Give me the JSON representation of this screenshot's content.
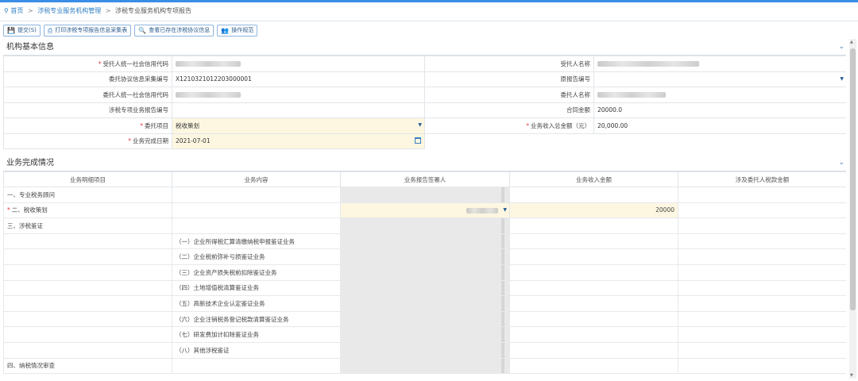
{
  "breadcrumb": {
    "home": "首页",
    "level1": "涉税专业服务机构管理",
    "level2": "涉税专业服务机构专项报告",
    "sep": ">"
  },
  "toolbar": {
    "submit": "提交(S)",
    "print": "打印涉税专项报告信息采集表",
    "view": "查看已存在涉税协议信息",
    "guide": "操作规范"
  },
  "basic": {
    "title": "机构基本信息",
    "rows": [
      {
        "l1": "受托人统一社会信用代码",
        "v1": "",
        "l2": "受托人名称",
        "v2": ""
      },
      {
        "l1": "委托协议信息采集编号",
        "v1": "X1210321012203000001",
        "l2": "原报告编号",
        "v2": ""
      },
      {
        "l1": "委托人统一社会信用代码",
        "v1": "",
        "l2": "委托人名称",
        "v2": ""
      },
      {
        "l1": "涉税专项业务报告编号",
        "v1": "",
        "l2": "合同金额",
        "v2": "20000.0"
      },
      {
        "l1": "委托项目",
        "v1": "税收策划",
        "l2": "业务收入总金额（元）",
        "v2": "20,000.00"
      },
      {
        "l1": "业务完成日期",
        "v1": "2021-07-01"
      }
    ],
    "required_mark": "*"
  },
  "completion": {
    "title": "业务完成情况",
    "columns": [
      "业务明细项目",
      "业务内容",
      "业务报告签署人",
      "业务收入金额",
      "涉及委托人税款金额"
    ],
    "rows": [
      {
        "item": "一、专业税务顾问",
        "content": "",
        "income": ""
      },
      {
        "item": "二、税收策划",
        "content": "",
        "income": "20000",
        "req": "*"
      },
      {
        "item": "三、涉税鉴证",
        "content": "",
        "income": ""
      },
      {
        "item": "",
        "content": "（一）企业所得税汇算清缴纳税申报鉴证业务",
        "income": ""
      },
      {
        "item": "",
        "content": "（二）企业税前弥补亏损鉴证业务",
        "income": ""
      },
      {
        "item": "",
        "content": "（三）企业资产损失税前扣除鉴证业务",
        "income": ""
      },
      {
        "item": "",
        "content": "（四）土地增值税清算鉴证业务",
        "income": ""
      },
      {
        "item": "",
        "content": "（五）高新技术企业认定鉴证业务",
        "income": ""
      },
      {
        "item": "",
        "content": "（六）企业注销税务登记税款清算鉴证业务",
        "income": ""
      },
      {
        "item": "",
        "content": "（七）研发费加计扣除鉴证业务",
        "income": ""
      },
      {
        "item": "",
        "content": "（八）其他涉税鉴证",
        "income": ""
      },
      {
        "item": "四、纳税情况审查",
        "content": "",
        "income": ""
      }
    ]
  }
}
